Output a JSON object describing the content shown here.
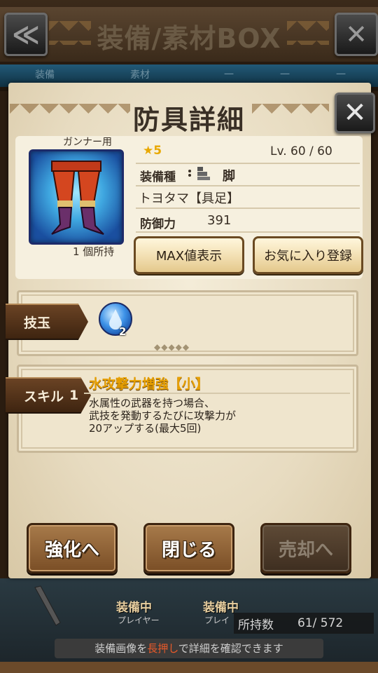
{
  "header": {
    "title": "装備/素材BOX",
    "back_glyph": "≪",
    "close_glyph": "✕",
    "tabs": [
      "装備",
      "素材",
      "一",
      "一",
      "一"
    ]
  },
  "panel": {
    "title": "防具詳細",
    "close_glyph": "✕"
  },
  "item": {
    "usage": "ガンナー用",
    "icon": "armor-legs-icon",
    "owned": "1 個所持",
    "rarity": "★5",
    "level": "Lv. 60 / 60",
    "type_label": "装備種",
    "type_value": "脚",
    "name": "トヨタマ【具足】",
    "defense_label": "防御力",
    "defense_value": "391"
  },
  "buttons": {
    "max_label": "MAX値表示",
    "favorite_label": "お気に入り登録",
    "enhance_label": "強化へ",
    "close_label": "閉じる",
    "sell_label": "売却へ"
  },
  "jewel": {
    "tag": "技玉",
    "icon": "water-jewel-icon",
    "count": "2",
    "dots": "◆◆◆◆◆"
  },
  "skill": {
    "tag": "スキル",
    "slot": "1",
    "name": "水攻撃力増強【小】",
    "desc_line1": "水属性の武器を持つ場合、",
    "desc_line2": "武技を発動するたびに攻撃力が",
    "desc_line3": "20アップする(最大5回)"
  },
  "bottom": {
    "equipped_label_1": "装備中",
    "player_label_1": "プレイヤー",
    "equipped_label_2": "装備中",
    "player_label_2": "プレイ",
    "count_label": "所持数",
    "count_value": "61/  572",
    "hint_pre": "装備画像を",
    "hint_highlight": "長押し",
    "hint_post": "で詳細を確認できます"
  },
  "colors": {
    "accent_gold": "#e8a000",
    "panel_bg": "#efe5cd",
    "button_brown": "#7a4e26"
  }
}
